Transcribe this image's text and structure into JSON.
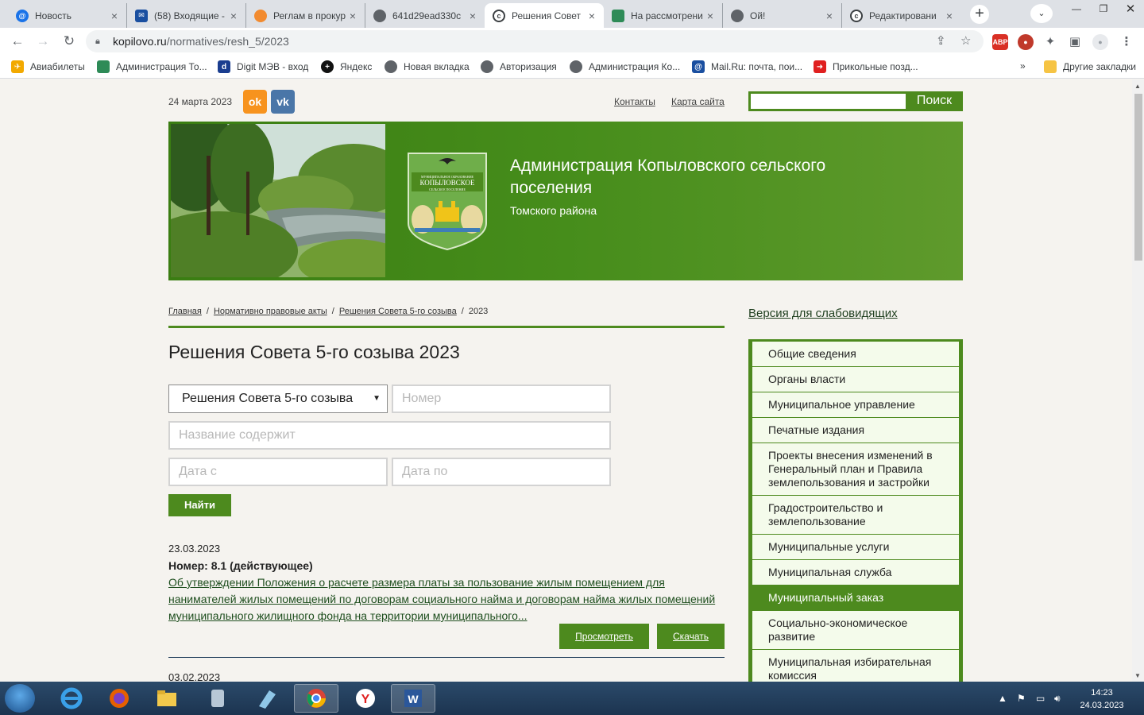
{
  "browser": {
    "tabs": [
      {
        "title": "Новость",
        "active": false
      },
      {
        "title": "(58) Входящие -",
        "active": false
      },
      {
        "title": "Реглам в прокур",
        "active": false
      },
      {
        "title": "641d29ead330c",
        "active": false
      },
      {
        "title": "Решения Совет",
        "active": true
      },
      {
        "title": "На рассмотрени",
        "active": false
      },
      {
        "title": "Ой!",
        "active": false
      },
      {
        "title": "Редактировани",
        "active": false
      }
    ],
    "url_host": "kopilovo.ru",
    "url_path": "/normatives/resh_5/2023",
    "bookmarks": [
      "Авиабилеты",
      "Администрация То...",
      "Digit МЭВ - вход",
      "Яндекс",
      "Новая вкладка",
      "Авторизация",
      "Администрация Ко...",
      "Mail.Ru: почта, пои...",
      "Прикольные позд...",
      "Другие закладки"
    ],
    "more_bookmarks": "»"
  },
  "site": {
    "date": "24 марта 2023",
    "social": {
      "ok": "ok",
      "vk": "vk"
    },
    "links": {
      "contacts": "Контакты",
      "sitemap": "Карта сайта"
    },
    "search_button": "Поиск",
    "banner_title": "Администрация Копыловского сельского поселения",
    "banner_subtitle": "Томского района",
    "crest_text": {
      "line1": "МУНИЦИПАЛЬНОЕ ОБРАЗОВАНИЕ",
      "line2": "КОПЫЛОВСКОЕ",
      "line3": "СЕЛЬСКОЕ ПОСЕЛЕНИЕ"
    },
    "breadcrumbs": [
      "Главная",
      "Нормативно правовые акты",
      "Решения Совета 5-го созыва",
      "2023"
    ],
    "breadcrumb_sep": "/",
    "page_title": "Решения Совета 5-го созыва 2023",
    "filter": {
      "category": "Решения Совета 5-го созыва",
      "number_placeholder": "Номер",
      "title_placeholder": "Название содержит",
      "date_from_placeholder": "Дата с",
      "date_to_placeholder": "Дата по",
      "find_button": "Найти"
    },
    "results": [
      {
        "date": "23.03.2023",
        "number": "Номер: 8.1 (действующее)",
        "title": "Об утверждении Положения о расчете размера платы за пользование жилым помещением для нанимателей жилых помещений по договорам социального найма и договорам найма жилых помещений муниципального жилищного фонда на территории муниципального...",
        "view_label": "Просмотреть",
        "download_label": "Скачать"
      },
      {
        "date": "03.02.2023"
      }
    ],
    "vision_link": "Версия для слабовидящих",
    "menu": [
      {
        "label": "Общие сведения",
        "active": false
      },
      {
        "label": "Органы власти",
        "active": false
      },
      {
        "label": "Муниципальное управление",
        "active": false
      },
      {
        "label": "Печатные издания",
        "active": false
      },
      {
        "label": "Проекты внесения изменений в Генеральный план и Правила землепользования и застройки",
        "active": false
      },
      {
        "label": "Градостроительство и землепользование",
        "active": false
      },
      {
        "label": "Муниципальные услуги",
        "active": false
      },
      {
        "label": "Муниципальная служба",
        "active": false
      },
      {
        "label": "Муниципальный заказ",
        "active": true
      },
      {
        "label": "Социально-экономическое развитие",
        "active": false
      },
      {
        "label": "Муниципальная избирательная комиссия",
        "active": false
      }
    ],
    "colors": {
      "green": "#4d8a1e",
      "page_bg": "#f5f3ef"
    }
  },
  "taskbar": {
    "time": "14:23",
    "date": "24.03.2023"
  }
}
